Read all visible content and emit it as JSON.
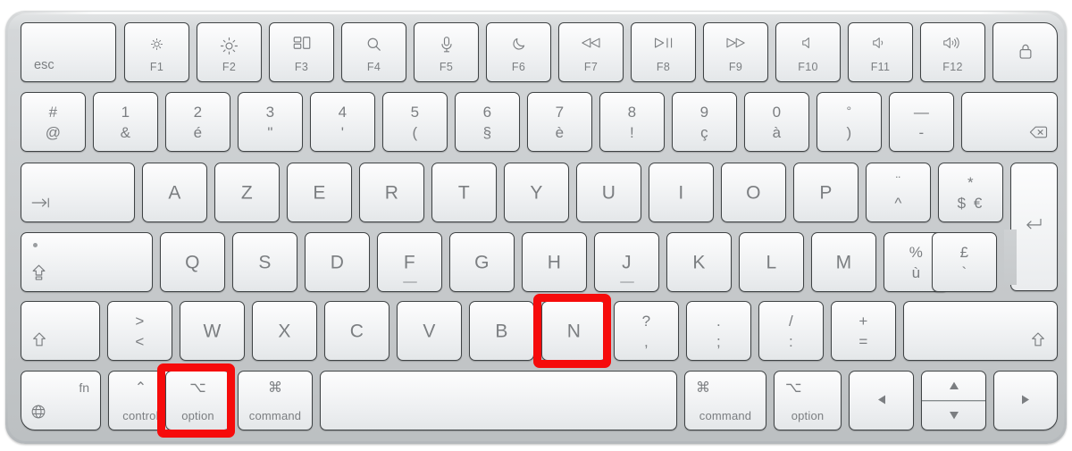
{
  "device": {
    "name": "Apple Magic Keyboard",
    "layout": "French AZERTY",
    "body_color": "#cbced0",
    "key_color": "#f4f6f7",
    "legend_color": "#7b7e81",
    "highlight_color": "#f60b0b"
  },
  "highlights": [
    {
      "key": "option-left",
      "label": "option",
      "color": "#f60b0b"
    },
    {
      "key": "n",
      "label": "N",
      "color": "#f60b0b"
    }
  ],
  "rows": {
    "function": [
      {
        "id": "esc",
        "label": "esc"
      },
      {
        "id": "f1",
        "fn": "F1",
        "icon": "brightness-down-icon",
        "glyph": "small-sun"
      },
      {
        "id": "f2",
        "fn": "F2",
        "icon": "brightness-up-icon",
        "glyph": "large-sun"
      },
      {
        "id": "f3",
        "fn": "F3",
        "icon": "mission-control-icon",
        "glyph": "windows-grid"
      },
      {
        "id": "f4",
        "fn": "F4",
        "icon": "spotlight-search-icon",
        "glyph": "magnifier"
      },
      {
        "id": "f5",
        "fn": "F5",
        "icon": "dictation-icon",
        "glyph": "microphone"
      },
      {
        "id": "f6",
        "fn": "F6",
        "icon": "do-not-disturb-icon",
        "glyph": "moon"
      },
      {
        "id": "f7",
        "fn": "F7",
        "icon": "rewind-icon",
        "glyph": "prev-track"
      },
      {
        "id": "f8",
        "fn": "F8",
        "icon": "play-pause-icon",
        "glyph": "play-pause"
      },
      {
        "id": "f9",
        "fn": "F9",
        "icon": "fast-forward-icon",
        "glyph": "next-track"
      },
      {
        "id": "f10",
        "fn": "F10",
        "icon": "mute-icon",
        "glyph": "speaker-mute"
      },
      {
        "id": "f11",
        "fn": "F11",
        "icon": "volume-down-icon",
        "glyph": "speaker-low"
      },
      {
        "id": "f12",
        "fn": "F12",
        "icon": "volume-up-icon",
        "glyph": "speaker-high"
      },
      {
        "id": "touchid",
        "icon": "lock-icon",
        "glyph": "padlock"
      }
    ],
    "numbers": [
      {
        "id": "hash",
        "top": "#",
        "bottom": "@"
      },
      {
        "id": "1",
        "top": "1",
        "bottom": "&"
      },
      {
        "id": "2",
        "top": "2",
        "bottom": "é"
      },
      {
        "id": "3",
        "top": "3",
        "bottom": "\""
      },
      {
        "id": "4",
        "top": "4",
        "bottom": "'"
      },
      {
        "id": "5",
        "top": "5",
        "bottom": "("
      },
      {
        "id": "6",
        "top": "6",
        "bottom": "§"
      },
      {
        "id": "7",
        "top": "7",
        "bottom": "è"
      },
      {
        "id": "8",
        "top": "8",
        "bottom": "!"
      },
      {
        "id": "9",
        "top": "9",
        "bottom": "ç"
      },
      {
        "id": "0",
        "top": "0",
        "bottom": "à"
      },
      {
        "id": "degree",
        "top": "°",
        "bottom": ")"
      },
      {
        "id": "minus",
        "top": "—",
        "bottom": "-"
      },
      {
        "id": "delete",
        "icon": "delete-backspace-icon",
        "glyph": "⌫"
      }
    ],
    "tab": [
      {
        "id": "tab",
        "icon": "tab-icon",
        "glyph": "⇥"
      },
      {
        "id": "a",
        "label": "A"
      },
      {
        "id": "z",
        "label": "Z"
      },
      {
        "id": "e",
        "label": "E"
      },
      {
        "id": "r",
        "label": "R"
      },
      {
        "id": "t",
        "label": "T"
      },
      {
        "id": "y",
        "label": "Y"
      },
      {
        "id": "u",
        "label": "U"
      },
      {
        "id": "i",
        "label": "I"
      },
      {
        "id": "o",
        "label": "O"
      },
      {
        "id": "p",
        "label": "P"
      },
      {
        "id": "circumflex",
        "top": "¨",
        "bottom": "^"
      },
      {
        "id": "dollar",
        "top": "*",
        "bottom": "$ €"
      }
    ],
    "caps": [
      {
        "id": "capslock",
        "icon": "caps-lock-icon",
        "glyph": "⇪",
        "indicator": true
      },
      {
        "id": "q",
        "label": "Q"
      },
      {
        "id": "s",
        "label": "S"
      },
      {
        "id": "d",
        "label": "D"
      },
      {
        "id": "f",
        "label": "F",
        "homing": true
      },
      {
        "id": "g",
        "label": "G"
      },
      {
        "id": "h",
        "label": "H"
      },
      {
        "id": "j",
        "label": "J",
        "homing": true
      },
      {
        "id": "k",
        "label": "K"
      },
      {
        "id": "l",
        "label": "L"
      },
      {
        "id": "m",
        "label": "M"
      },
      {
        "id": "percent",
        "top": "%",
        "bottom": "ù"
      },
      {
        "id": "pound",
        "top": "£",
        "bottom": "`"
      }
    ],
    "shift": [
      {
        "id": "shift-left",
        "icon": "shift-icon",
        "glyph": "⇧"
      },
      {
        "id": "anglebrackets",
        "top": ">",
        "bottom": "<"
      },
      {
        "id": "w",
        "label": "W"
      },
      {
        "id": "x",
        "label": "X"
      },
      {
        "id": "c",
        "label": "C"
      },
      {
        "id": "v",
        "label": "V"
      },
      {
        "id": "b",
        "label": "B"
      },
      {
        "id": "n",
        "label": "N"
      },
      {
        "id": "question",
        "top": "?",
        "bottom": ","
      },
      {
        "id": "semicolon",
        "top": ".",
        "bottom": ";"
      },
      {
        "id": "slash",
        "top": "/",
        "bottom": ":"
      },
      {
        "id": "plus",
        "top": "+",
        "bottom": "="
      },
      {
        "id": "shift-right",
        "icon": "shift-icon",
        "glyph": "⇧"
      }
    ],
    "bottom": [
      {
        "id": "fn",
        "label": "fn",
        "icon": "globe-icon",
        "glyph": "🌐"
      },
      {
        "id": "control-left",
        "label": "control",
        "symbol": "⌃"
      },
      {
        "id": "option-left",
        "label": "option",
        "symbol": "⌥"
      },
      {
        "id": "command-left",
        "label": "command",
        "symbol": "⌘"
      },
      {
        "id": "space",
        "label": ""
      },
      {
        "id": "command-right",
        "label": "command",
        "symbol": "⌘"
      },
      {
        "id": "option-right",
        "label": "option",
        "symbol": "⌥"
      },
      {
        "id": "arrow-left",
        "icon": "arrow-left-icon",
        "glyph": "◀"
      },
      {
        "id": "arrow-updown",
        "up": "▲",
        "down": "▼"
      },
      {
        "id": "arrow-right",
        "icon": "arrow-right-icon",
        "glyph": "▶"
      }
    ]
  }
}
